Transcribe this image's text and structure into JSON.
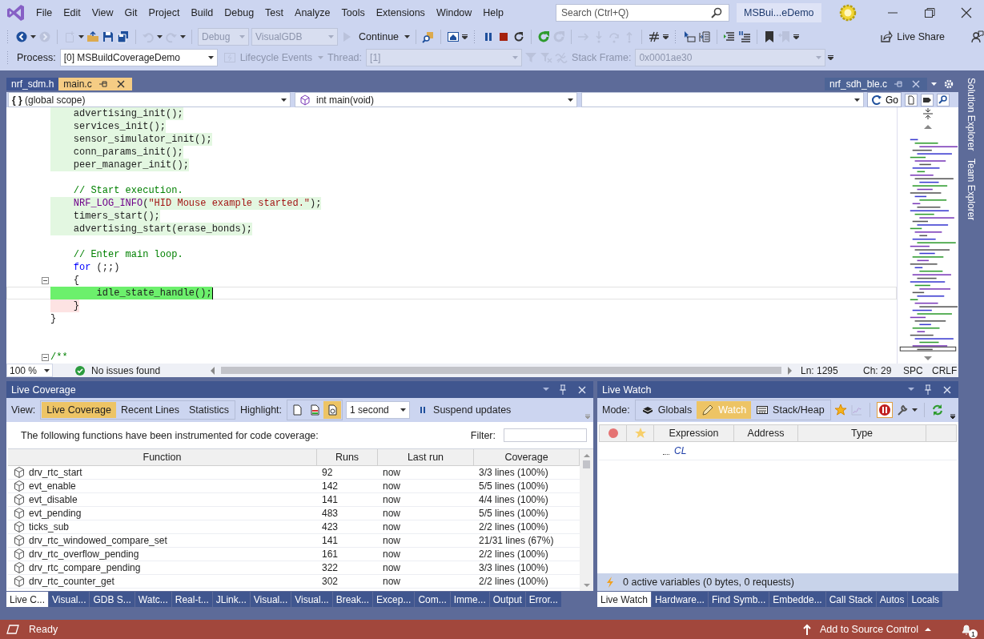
{
  "title_bar": {
    "menu": [
      "File",
      "Edit",
      "View",
      "Git",
      "Project",
      "Build",
      "Debug",
      "Test",
      "Analyze",
      "Tools",
      "Extensions",
      "Window",
      "Help"
    ],
    "search": {
      "placeholder": "Search (Ctrl+Q)"
    },
    "solution_name": "MSBui...eDemo"
  },
  "standard_toolbar": {
    "items": [
      {
        "kind": "grip"
      },
      {
        "kind": "back",
        "disabled": false
      },
      {
        "kind": "caret",
        "disabled": false
      },
      {
        "kind": "forward",
        "disabled": true
      },
      {
        "kind": "separator"
      },
      {
        "kind": "new",
        "disabled": true
      },
      {
        "kind": "caret",
        "disabled": false
      },
      {
        "kind": "open",
        "disabled": false
      },
      {
        "kind": "save",
        "disabled": false
      },
      {
        "kind": "saveall",
        "disabled": false
      },
      {
        "kind": "separator"
      },
      {
        "kind": "undo",
        "disabled": true
      },
      {
        "kind": "caret",
        "disabled": false
      },
      {
        "kind": "redo",
        "disabled": true
      },
      {
        "kind": "caret",
        "disabled": false
      },
      {
        "kind": "separator"
      },
      {
        "kind": "combo",
        "text": "Debug",
        "disabled": true
      },
      {
        "kind": "combo",
        "text": "VisualGDB",
        "disabled": true
      },
      {
        "kind": "continue",
        "text": "Continue",
        "disabled": false
      },
      {
        "kind": "caret",
        "disabled": false
      },
      {
        "kind": "separator"
      },
      {
        "kind": "find",
        "disabled": false
      },
      {
        "kind": "separator"
      },
      {
        "kind": "window",
        "disabled": false
      },
      {
        "kind": "overflow"
      },
      {
        "kind": "grip"
      },
      {
        "kind": "pause",
        "disabled": false
      },
      {
        "kind": "stop",
        "disabled": false
      },
      {
        "kind": "restart",
        "disabled": false
      },
      {
        "kind": "separator"
      },
      {
        "kind": "refresh",
        "disabled": false
      },
      {
        "kind": "refresh",
        "disabled": true
      },
      {
        "kind": "separator"
      },
      {
        "kind": "shownext",
        "disabled": true
      },
      {
        "kind": "stepinto",
        "disabled": true
      },
      {
        "kind": "stepover",
        "disabled": true
      },
      {
        "kind": "stepout",
        "disabled": true
      },
      {
        "kind": "separator"
      },
      {
        "kind": "hatch",
        "disabled": false
      },
      {
        "kind": "overflow"
      },
      {
        "kind": "grip"
      },
      {
        "kind": "pointer",
        "disabled": false
      },
      {
        "kind": "columns",
        "disabled": false
      },
      {
        "kind": "separator"
      },
      {
        "kind": "indent",
        "disabled": false
      },
      {
        "kind": "comment",
        "disabled": false
      },
      {
        "kind": "separator"
      },
      {
        "kind": "bookmark",
        "disabled": false
      },
      {
        "kind": "bookmarkprev",
        "disabled": true
      },
      {
        "kind": "overflow"
      },
      {
        "kind": "spacer"
      },
      {
        "kind": "liveshare",
        "text": "Live Share",
        "disabled": false
      },
      {
        "kind": "feedback",
        "disabled": false
      }
    ]
  },
  "debug_toolbar": {
    "items": [
      {
        "kind": "grip"
      },
      {
        "kind": "label",
        "text": "Process:",
        "disabled": false
      },
      {
        "kind": "combo",
        "text": "[0] MSBuildCoverageDemo",
        "disabled": false
      },
      {
        "kind": "lifecycle",
        "text": "Lifecycle Events",
        "disabled": true
      },
      {
        "kind": "caret",
        "disabled": true
      },
      {
        "kind": "label",
        "text": "Thread:",
        "disabled": true
      },
      {
        "kind": "combo",
        "text": "[1]",
        "disabled": true
      },
      {
        "kind": "filter",
        "disabled": true
      },
      {
        "kind": "filterclear",
        "disabled": true
      },
      {
        "kind": "unlink",
        "disabled": true
      },
      {
        "kind": "label",
        "text": "Stack Frame:",
        "disabled": true
      },
      {
        "kind": "combo",
        "text": "0x0001ae30",
        "disabled": true
      },
      {
        "kind": "overflow"
      }
    ]
  },
  "editor": {
    "tabs": [
      {
        "label": "nrf_sdm.h",
        "kind": "document",
        "selected": false
      },
      {
        "label": "main.c",
        "kind": "document",
        "selected": true
      },
      {
        "label": "nrf_sdh_ble.c",
        "kind": "preview",
        "selected": false
      }
    ],
    "navigation": {
      "scope_prefix": "{ }",
      "scope": "(global scope)",
      "member": "int main(void)",
      "go_button": "Go"
    },
    "lines": [
      {
        "kind": "covered",
        "fold": false,
        "current": false,
        "tokens": [
          {
            "kind": "plain",
            "text": "    advertising_init();"
          }
        ]
      },
      {
        "kind": "covered",
        "fold": false,
        "current": false,
        "tokens": [
          {
            "kind": "plain",
            "text": "    services_init();"
          }
        ]
      },
      {
        "kind": "covered",
        "fold": false,
        "current": false,
        "tokens": [
          {
            "kind": "plain",
            "text": "    sensor_simulator_init();"
          }
        ]
      },
      {
        "kind": "covered",
        "fold": false,
        "current": false,
        "tokens": [
          {
            "kind": "plain",
            "text": "    conn_params_init();"
          }
        ]
      },
      {
        "kind": "covered",
        "fold": false,
        "current": false,
        "tokens": [
          {
            "kind": "plain",
            "text": "    peer_manager_init();"
          }
        ]
      },
      {
        "fold": false,
        "current": false
      },
      {
        "kind": "plain",
        "fold": false,
        "current": false,
        "tokens": [
          {
            "kind": "comment",
            "text": "    // Start execution."
          }
        ]
      },
      {
        "kind": "covered",
        "fold": false,
        "current": false,
        "tokens": [
          {
            "kind": "macro",
            "text": "    NRF_LOG_INFO"
          },
          {
            "kind": "plain",
            "text": "("
          },
          {
            "kind": "string",
            "text": "\"HID Mouse example started.\""
          },
          {
            "kind": "plain",
            "text": ");"
          }
        ]
      },
      {
        "kind": "covered",
        "fold": false,
        "current": false,
        "tokens": [
          {
            "kind": "plain",
            "text": "    timers_start();"
          }
        ]
      },
      {
        "kind": "covered",
        "fold": false,
        "current": false,
        "tokens": [
          {
            "kind": "plain",
            "text": "    advertising_start(erase_bonds);"
          }
        ]
      },
      {
        "fold": false,
        "current": false
      },
      {
        "kind": "plain",
        "fold": false,
        "current": false,
        "tokens": [
          {
            "kind": "comment",
            "text": "    // Enter main loop."
          }
        ]
      },
      {
        "kind": "plain",
        "fold": false,
        "current": false,
        "tokens": [
          {
            "kind": "keyword",
            "text": "    for"
          },
          {
            "kind": "plain",
            "text": " (;;)"
          }
        ]
      },
      {
        "kind": "plain",
        "fold": true,
        "current": false,
        "tokens": [
          {
            "kind": "plain",
            "text": "    {"
          }
        ]
      },
      {
        "kind": "hot",
        "fold": false,
        "current": true,
        "tokens": [
          {
            "kind": "plain",
            "text": "        idle_state_handle();"
          }
        ]
      },
      {
        "kind": "uncovered",
        "fold": false,
        "current": false,
        "tokens": [
          {
            "kind": "plain",
            "text": "    }"
          }
        ]
      },
      {
        "kind": "plain",
        "fold": false,
        "current": false,
        "tokens": [
          {
            "kind": "plain",
            "text": "}"
          }
        ]
      },
      {
        "fold": false,
        "current": false
      },
      {
        "fold": false,
        "current": false
      },
      {
        "kind": "plain",
        "fold": true,
        "current": false,
        "tokens": [
          {
            "kind": "comment",
            "text": "/**"
          }
        ]
      }
    ],
    "status": {
      "zoom": "100 %",
      "issues": "No issues found",
      "line": "Ln: 1295",
      "column": "Ch: 29",
      "whitespace": "SPC",
      "line_ending": "CRLF"
    }
  },
  "side_tabs": [
    "Solution Explorer",
    "Team Explorer"
  ],
  "live_coverage": {
    "title": "Live Coverage",
    "view_label": "View:",
    "views": [
      {
        "label": "Live Coverage",
        "selected": true
      },
      {
        "label": "Recent Lines",
        "selected": false
      },
      {
        "label": "Statistics",
        "selected": false
      }
    ],
    "highlight_label": "Highlight:",
    "highlight_modes": [
      {
        "selected": false
      },
      {
        "selected": false
      },
      {
        "selected": true
      }
    ],
    "interval": "1 second",
    "suspend_button": "Suspend updates",
    "description": "The following functions have been instrumented for code coverage:",
    "filter_label": "Filter:",
    "columns": [
      "Function",
      "Runs",
      "Last run",
      "Coverage"
    ],
    "rows": [
      {
        "function": "drv_rtc_start",
        "runs": "92",
        "last_run": "now",
        "coverage": "3/3 lines (100%)"
      },
      {
        "function": "evt_enable",
        "runs": "142",
        "last_run": "now",
        "coverage": "5/5 lines (100%)"
      },
      {
        "function": "evt_disable",
        "runs": "141",
        "last_run": "now",
        "coverage": "4/4 lines (100%)"
      },
      {
        "function": "evt_pending",
        "runs": "483",
        "last_run": "now",
        "coverage": "5/5 lines (100%)"
      },
      {
        "function": "ticks_sub",
        "runs": "423",
        "last_run": "now",
        "coverage": "2/2 lines (100%)"
      },
      {
        "function": "drv_rtc_windowed_compare_set",
        "runs": "141",
        "last_run": "now",
        "coverage": "21/31 lines (67%)"
      },
      {
        "function": "drv_rtc_overflow_pending",
        "runs": "161",
        "last_run": "now",
        "coverage": "2/2 lines (100%)"
      },
      {
        "function": "drv_rtc_compare_pending",
        "runs": "322",
        "last_run": "now",
        "coverage": "3/3 lines (100%)"
      },
      {
        "function": "drv_rtc_counter_get",
        "runs": "302",
        "last_run": "now",
        "coverage": "2/2 lines (100%)"
      }
    ],
    "tabs": [
      {
        "label": "Live C...",
        "selected": true
      },
      {
        "label": "Visual...",
        "selected": false
      },
      {
        "label": "GDB S...",
        "selected": false
      },
      {
        "label": "Watc...",
        "selected": false
      },
      {
        "label": "Real-t...",
        "selected": false
      },
      {
        "label": "JLink...",
        "selected": false
      },
      {
        "label": "Visual...",
        "selected": false
      },
      {
        "label": "Visual...",
        "selected": false
      },
      {
        "label": "Break...",
        "selected": false
      },
      {
        "label": "Excep...",
        "selected": false
      },
      {
        "label": "Com...",
        "selected": false
      },
      {
        "label": "Imme...",
        "selected": false
      },
      {
        "label": "Output",
        "selected": false
      },
      {
        "label": "Error...",
        "selected": false
      }
    ]
  },
  "live_watch": {
    "title": "Live Watch",
    "mode_label": "Mode:",
    "modes": [
      {
        "label": "Globals",
        "selected": false
      },
      {
        "label": "Watch",
        "selected": true
      },
      {
        "label": "Stack/Heap",
        "selected": false
      }
    ],
    "columns": [
      "Expression",
      "Address",
      "Type"
    ],
    "rows": [
      {
        "expression": "CL"
      }
    ],
    "summary": "0 active variables (0 bytes, 0 requests)",
    "tabs": [
      {
        "label": "Live Watch",
        "selected": true
      },
      {
        "label": "Hardware...",
        "selected": false
      },
      {
        "label": "Find Symb...",
        "selected": false
      },
      {
        "label": "Embedde...",
        "selected": false
      },
      {
        "label": "Call Stack",
        "selected": false
      },
      {
        "label": "Autos",
        "selected": false
      },
      {
        "label": "Locals",
        "selected": false
      }
    ]
  },
  "status_bar": {
    "state": "Ready",
    "source_control": "Add to Source Control",
    "notifications": "1"
  }
}
